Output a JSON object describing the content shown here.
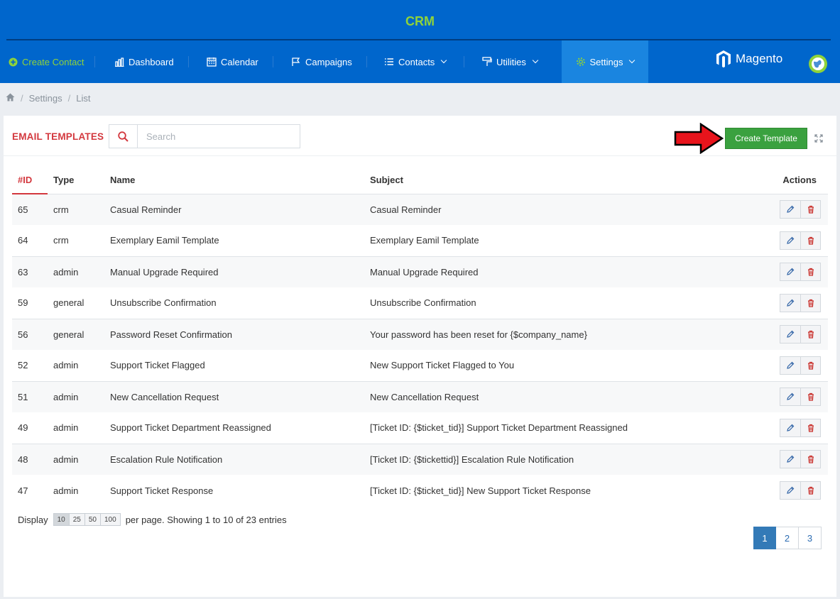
{
  "header": {
    "title": "CRM",
    "nav": [
      {
        "label": "Create Contact",
        "icon": "plus-circle-icon"
      },
      {
        "label": "Dashboard",
        "icon": "bar-chart-icon"
      },
      {
        "label": "Calendar",
        "icon": "calendar-icon"
      },
      {
        "label": "Campaigns",
        "icon": "flag-icon"
      },
      {
        "label": "Contacts",
        "icon": "list-icon"
      },
      {
        "label": "Utilities",
        "icon": "paint-roller-icon"
      },
      {
        "label": "Settings",
        "icon": "gear-icon"
      }
    ],
    "logo_text": "Magento"
  },
  "breadcrumb": [
    "Settings",
    "List"
  ],
  "panel": {
    "title": "EMAIL TEMPLATES",
    "search_placeholder": "Search",
    "create_label": "Create Template"
  },
  "table": {
    "columns": [
      "#ID",
      "Type",
      "Name",
      "Subject",
      "Actions"
    ],
    "rows": [
      {
        "id": "65",
        "type": "crm",
        "name": "Casual Reminder",
        "subject": "Casual Reminder"
      },
      {
        "id": "64",
        "type": "crm",
        "name": "Exemplary Eamil Template",
        "subject": "Exemplary Eamil Template"
      },
      {
        "id": "63",
        "type": "admin",
        "name": "Manual Upgrade Required",
        "subject": "Manual Upgrade Required"
      },
      {
        "id": "59",
        "type": "general",
        "name": "Unsubscribe Confirmation",
        "subject": "Unsubscribe Confirmation"
      },
      {
        "id": "56",
        "type": "general",
        "name": "Password Reset Confirmation",
        "subject": "Your password has been reset for {$company_name}"
      },
      {
        "id": "52",
        "type": "admin",
        "name": "Support Ticket Flagged",
        "subject": "New Support Ticket Flagged to You"
      },
      {
        "id": "51",
        "type": "admin",
        "name": "New Cancellation Request",
        "subject": "New Cancellation Request"
      },
      {
        "id": "49",
        "type": "admin",
        "name": "Support Ticket Department Reassigned",
        "subject": "[Ticket ID: {$ticket_tid}] Support Ticket Department Reassigned"
      },
      {
        "id": "48",
        "type": "admin",
        "name": "Escalation Rule Notification",
        "subject": "[Ticket ID: {$tickettid}] Escalation Rule Notification"
      },
      {
        "id": "47",
        "type": "admin",
        "name": "Support Ticket Response",
        "subject": "[Ticket ID: {$ticket_tid}] New Support Ticket Response"
      }
    ]
  },
  "footer": {
    "display_label": "Display",
    "lengths": [
      "10",
      "25",
      "50",
      "100"
    ],
    "selected_length": "10",
    "info": "per page. Showing 1 to 10 of 23 entries"
  },
  "pagination": {
    "pages": [
      "1",
      "2",
      "3"
    ],
    "current": "1"
  },
  "colors": {
    "header_bg": "#0066cc",
    "accent_green": "#8fd33a",
    "title_red": "#d3383e",
    "button_green": "#3aa13f"
  }
}
